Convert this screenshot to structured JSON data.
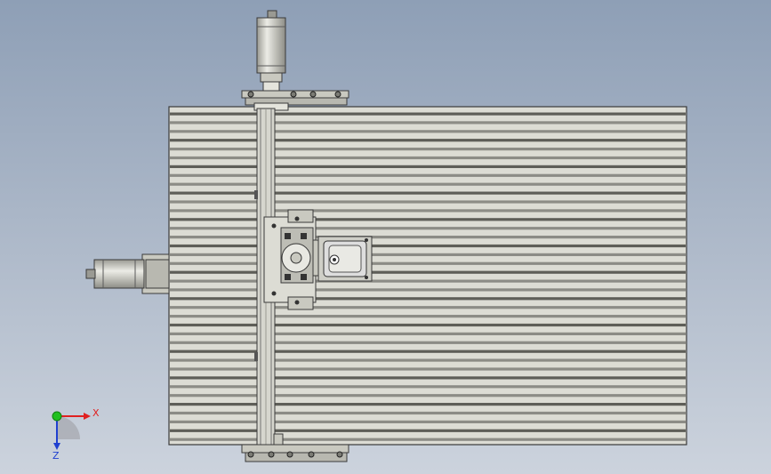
{
  "viewport": {
    "background_top": "#8e9fb6",
    "background_bottom": "#ccd3dd"
  },
  "model": {
    "bed_fill": "#dcdcd4",
    "metal_light": "#e4e4dc",
    "metal_mid": "#c9c9c0",
    "metal_dark": "#7b7b74",
    "edge": "#3a3a3a",
    "slot_count": 38
  },
  "triad": {
    "x_label": "X",
    "z_label": "Z",
    "x_color": "#e02020",
    "y_color": "#20c020",
    "z_color": "#2040d0",
    "icon": "coordinate-triad-icon"
  }
}
